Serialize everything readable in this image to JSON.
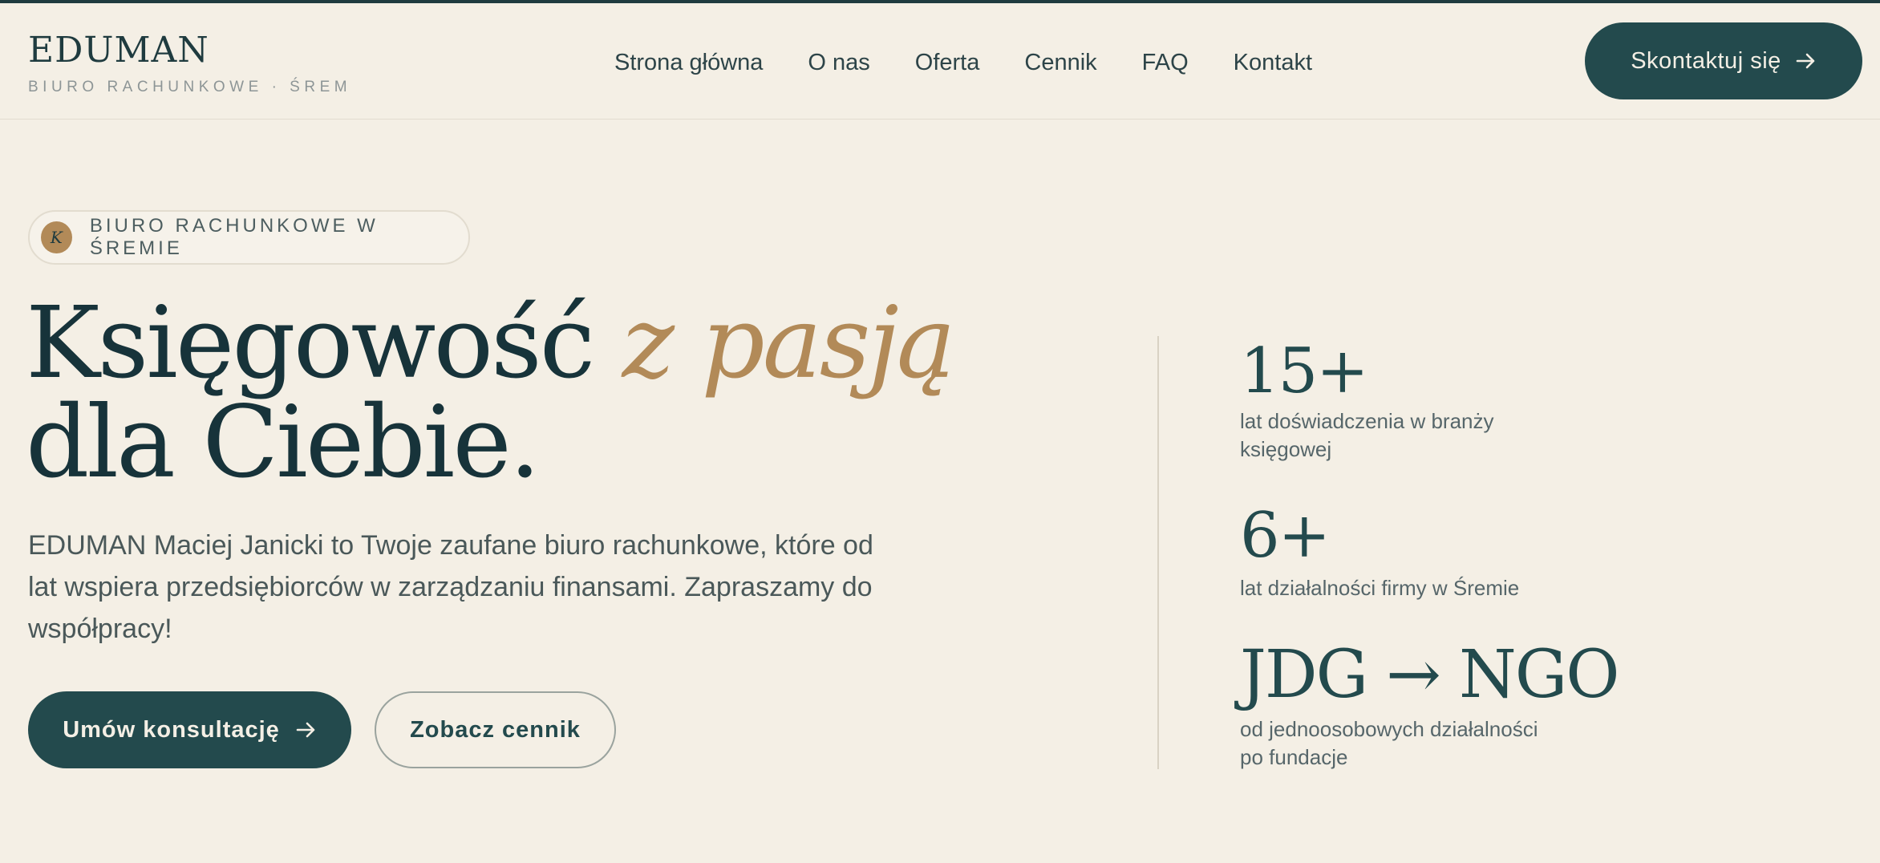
{
  "brand": {
    "name": "EDUMAN",
    "subtitle": "BIURO RACHUNKOWE · ŚREM"
  },
  "nav": {
    "items": [
      "Strona główna",
      "O nas",
      "Oferta",
      "Cennik",
      "FAQ",
      "Kontakt"
    ]
  },
  "header_cta": {
    "label": "Skontaktuj się",
    "icon": "arrow-right-icon"
  },
  "hero": {
    "badge_letter": "K",
    "badge_text": "BIURO RACHUNKOWE W ŚREMIE",
    "title_part1": "Księgowość ",
    "title_accent": "z pasją",
    "title_part2": "dla Ciebie.",
    "lead": "EDUMAN Maciej Janicki to Twoje zaufane biuro rachunkowe, które od lat wspiera przedsiębiorców w zarządzaniu finansami. Zapraszamy do współpracy!",
    "primary_button": "Umów konsultację",
    "secondary_button": "Zobacz cennik"
  },
  "stats": [
    {
      "value": "15+",
      "label": "lat doświadczenia w branży księgowej"
    },
    {
      "value": "6+",
      "label": "lat działalności firmy w Śremie"
    },
    {
      "value": "JDG → NGO",
      "label": "od jednoosobowych działalności po fundacje"
    }
  ],
  "colors": {
    "background": "#f4efe5",
    "primary": "#234a4d",
    "accent": "#b28a58",
    "text": "#17333a"
  }
}
